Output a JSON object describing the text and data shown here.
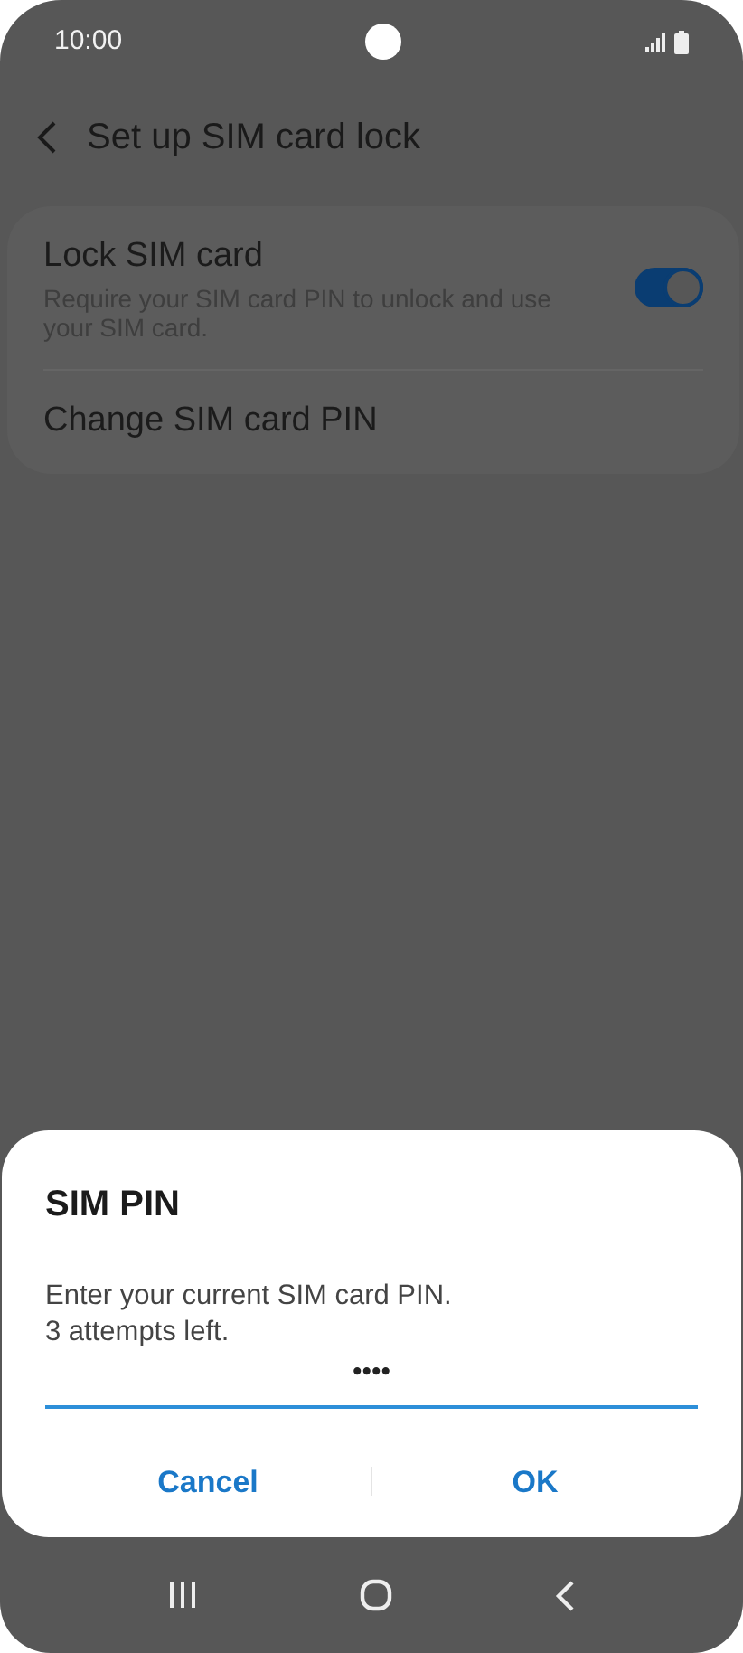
{
  "status_bar": {
    "time": "10:00"
  },
  "header": {
    "title": "Set up SIM card lock"
  },
  "settings": [
    {
      "kind": "toggle",
      "title": "Lock SIM card",
      "subtitle": "Require your SIM card PIN to unlock and use your SIM card.",
      "on": true
    },
    {
      "kind": "link",
      "title": "Change SIM card PIN"
    }
  ],
  "dialog": {
    "title": "SIM PIN",
    "message_lines": [
      "Enter your current SIM card PIN.",
      "3 attempts left."
    ],
    "pin_value": "••••",
    "buttons": [
      "Cancel",
      "OK"
    ]
  }
}
